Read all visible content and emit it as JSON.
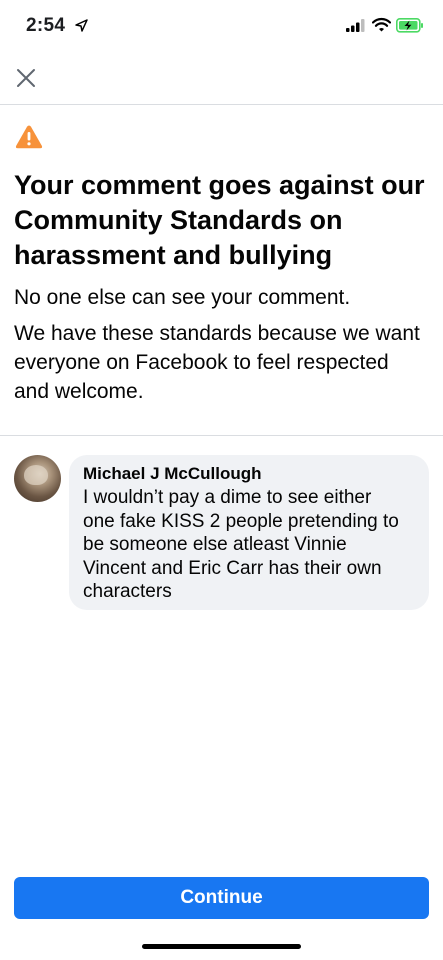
{
  "status_bar": {
    "time": "2:54",
    "icons": [
      "location-arrow-icon",
      "signal-icon",
      "wifi-icon",
      "battery-charging-icon"
    ]
  },
  "header": {
    "close_icon": "close-icon"
  },
  "alert": {
    "icon": "warning-triangle-icon",
    "icon_color": "#f7923a",
    "title": "Your comment goes against our Community Standards on harassment and bullying",
    "subtitle": "No one else can see your comment.",
    "body": "We have these standards because we want everyone on Facebook to feel respected and welcome."
  },
  "comment": {
    "author": "Michael J McCullough",
    "text": "I wouldn’t pay a dime to see either one fake KISS 2 people pretending to be someone else atleast Vinnie Vincent and Eric Carr has their own characters"
  },
  "footer": {
    "continue_label": "Continue",
    "button_color": "#1877f2"
  }
}
